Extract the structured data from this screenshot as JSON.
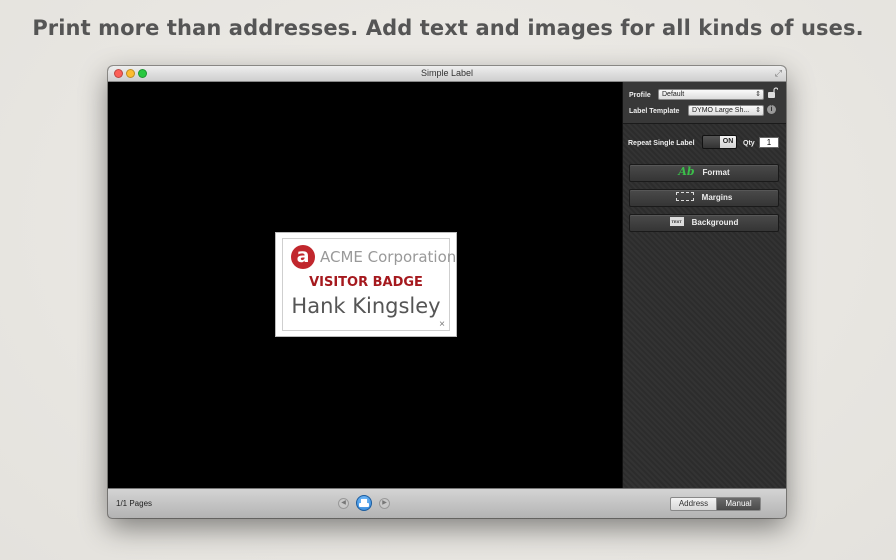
{
  "headline": "Print more than addresses. Add text and images for all kinds of uses.",
  "window": {
    "title": "Simple Label"
  },
  "label": {
    "logo_letter": "a",
    "company": "ACME Corporation",
    "badge_title": "VISITOR BADGE",
    "person_name": "Hank Kingsley",
    "close_glyph": "×",
    "accent_color": "#a5191e"
  },
  "sidebar": {
    "profile_label": "Profile",
    "profile_value": "Default",
    "template_label": "Label Template",
    "template_value": "DYMO Large Sh...",
    "repeat_label": "Repeat Single Label",
    "toggle_state": "ON",
    "qty_label": "Qty",
    "qty_value": "1",
    "buttons": [
      {
        "label": "Format",
        "icon": "format-icon",
        "icon_text": "Ab"
      },
      {
        "label": "Margins",
        "icon": "margins-icon"
      },
      {
        "label": "Background",
        "icon": "background-icon",
        "icon_text": "TEXT"
      }
    ]
  },
  "bottombar": {
    "pages_text": "1/1 Pages",
    "prev_glyph": "◀",
    "next_glyph": "▶",
    "segments": [
      "Address",
      "Manual"
    ],
    "selected_segment": "Manual"
  }
}
